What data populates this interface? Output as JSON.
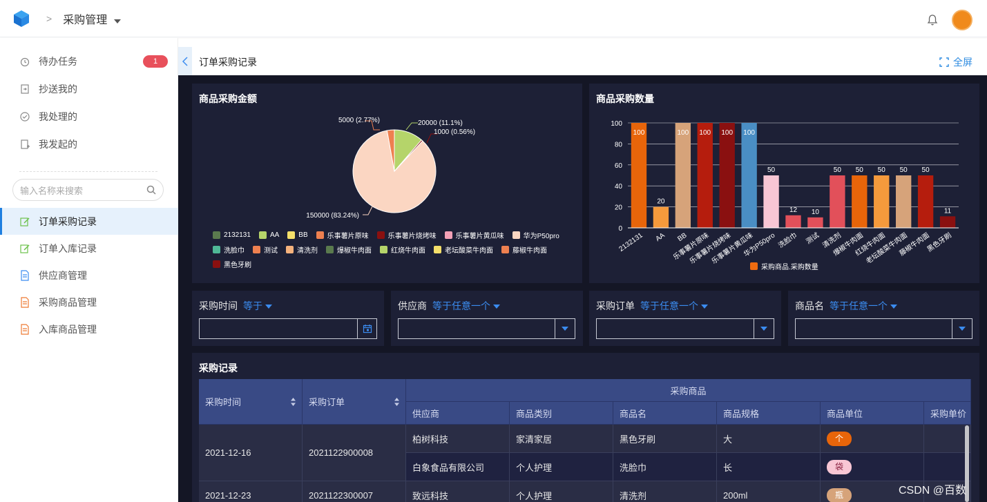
{
  "header": {
    "app_title": "采购管理",
    "breadcrumb_sep": ">"
  },
  "sidebar": {
    "items": [
      {
        "label": "待办任务",
        "badge": "1",
        "icon": "alarm-clock-icon"
      },
      {
        "label": "抄送我的",
        "icon": "forward-doc-icon"
      },
      {
        "label": "我处理的",
        "icon": "check-circle-icon"
      },
      {
        "label": "我发起的",
        "icon": "add-doc-icon"
      }
    ],
    "search_placeholder": "输入名称来搜索",
    "nav": [
      {
        "label": "订单采购记录",
        "icon": "edit-green-icon",
        "active": true
      },
      {
        "label": "订单入库记录",
        "icon": "edit-green-icon"
      },
      {
        "label": "供应商管理",
        "icon": "doc-blue-icon"
      },
      {
        "label": "采购商品管理",
        "icon": "doc-orange-icon"
      },
      {
        "label": "入库商品管理",
        "icon": "doc-orange-icon"
      }
    ]
  },
  "content": {
    "page_title": "订单采购记录",
    "fullscreen_label": "全屏"
  },
  "pie": {
    "title": "商品采购金额",
    "labels": [
      "5000 (2.77%)",
      "20000 (11.1%)",
      "1000 (0.56%)",
      "150000 (83.24%)"
    ],
    "legend": [
      {
        "name": "2132131",
        "color": "#5a7a4e"
      },
      {
        "name": "AA",
        "color": "#b5d46a"
      },
      {
        "name": "BB",
        "color": "#f4df6a"
      },
      {
        "name": "乐事薯片原味",
        "color": "#ee8050"
      },
      {
        "name": "乐事薯片烧烤味",
        "color": "#8a1010"
      },
      {
        "name": "乐事薯片黄瓜味",
        "color": "#f3a1b7"
      },
      {
        "name": "华为P50pro",
        "color": "#fbd6c2"
      },
      {
        "name": "洗脸巾",
        "color": "#4fb896"
      },
      {
        "name": "测试",
        "color": "#ee8050"
      },
      {
        "name": "清洗剂",
        "color": "#f5b27d"
      },
      {
        "name": "爆椒牛肉面",
        "color": "#5a7a4e"
      },
      {
        "name": "红烧牛肉面",
        "color": "#b5d46a"
      },
      {
        "name": "老坛酸菜牛肉面",
        "color": "#f4df6a"
      },
      {
        "name": "藤椒牛肉面",
        "color": "#ee8050"
      },
      {
        "name": "黑色牙刷",
        "color": "#8a1010"
      }
    ]
  },
  "bar": {
    "title": "商品采购数量",
    "legend_label": "采购商品.采购数量",
    "legend_color": "#ee6b10"
  },
  "chart_data": [
    {
      "type": "pie",
      "title": "商品采购金额",
      "slices": [
        {
          "name": "华为P50pro",
          "value": 150000,
          "percent": 83.24,
          "color": "#fbd6c2"
        },
        {
          "name": "乐事薯片原味",
          "value": 5000,
          "percent": 2.77,
          "color": "#ee8050"
        },
        {
          "name": "AA",
          "value": 20000,
          "percent": 11.1,
          "color": "#b5d46a"
        },
        {
          "name": "乐事薯片烧烤味",
          "value": 1000,
          "percent": 0.56,
          "color": "#8a1010"
        }
      ]
    },
    {
      "type": "bar",
      "title": "商品采购数量",
      "categories": [
        "2132131",
        "AA",
        "BB",
        "乐事薯片原味",
        "乐事薯片烧烤味",
        "乐事薯片黄瓜味",
        "华为P50pro",
        "洗脸巾",
        "测试",
        "清洗剂",
        "爆椒牛肉面",
        "红烧牛肉面",
        "老坛酸菜牛肉面",
        "藤椒牛肉面",
        "黑色牙刷"
      ],
      "series": [
        {
          "name": "采购商品.采购数量",
          "values": [
            100,
            20,
            100,
            100,
            100,
            100,
            50,
            12,
            10,
            50,
            50,
            50,
            50,
            50,
            11
          ]
        }
      ],
      "colors": [
        "#e8650a",
        "#f59a3c",
        "#d6a37a",
        "#b51d0d",
        "#8a1010",
        "#4a8ec4",
        "#f8c6d4",
        "#e2505a",
        "#e2505a",
        "#e2505a",
        "#e8650a",
        "#f59a3c",
        "#d6a37a",
        "#b51d0d",
        "#8a1010"
      ],
      "ylim": [
        0,
        100
      ],
      "yticks": [
        "0",
        "20",
        "40",
        "60",
        "80",
        "100"
      ],
      "grid": true
    }
  ],
  "filters": [
    {
      "label": "采购时间",
      "op": "等于"
    },
    {
      "label": "供应商",
      "op": "等于任意一个"
    },
    {
      "label": "采购订单",
      "op": "等于任意一个"
    },
    {
      "label": "商品名",
      "op": "等于任意一个"
    }
  ],
  "records": {
    "title": "采购记录",
    "group_header": "采购商品",
    "columns": [
      "采购时间",
      "采购订单",
      "供应商",
      "商品类别",
      "商品名",
      "商品规格",
      "商品单位",
      "采购单价"
    ],
    "rows": [
      {
        "time": "2021-12-16",
        "order": "2021122900008",
        "items": [
          {
            "supplier": "柏树科技",
            "category": "家清家居",
            "name": "黑色牙刷",
            "spec": "大",
            "unit": "个",
            "unit_color": "#e8650a"
          },
          {
            "supplier": "白象食品有限公司",
            "category": "个人护理",
            "name": "洗脸巾",
            "spec": "长",
            "unit": "袋",
            "unit_color": "#f8c6d4"
          }
        ]
      },
      {
        "time": "2021-12-23",
        "order": "2021122300007",
        "items": [
          {
            "supplier": "致远科技",
            "category": "个人护理",
            "name": "清洗剂",
            "spec": "200ml",
            "unit": "瓶",
            "unit_color": "#d6a37a"
          }
        ]
      }
    ]
  },
  "watermark": "CSDN @百数"
}
